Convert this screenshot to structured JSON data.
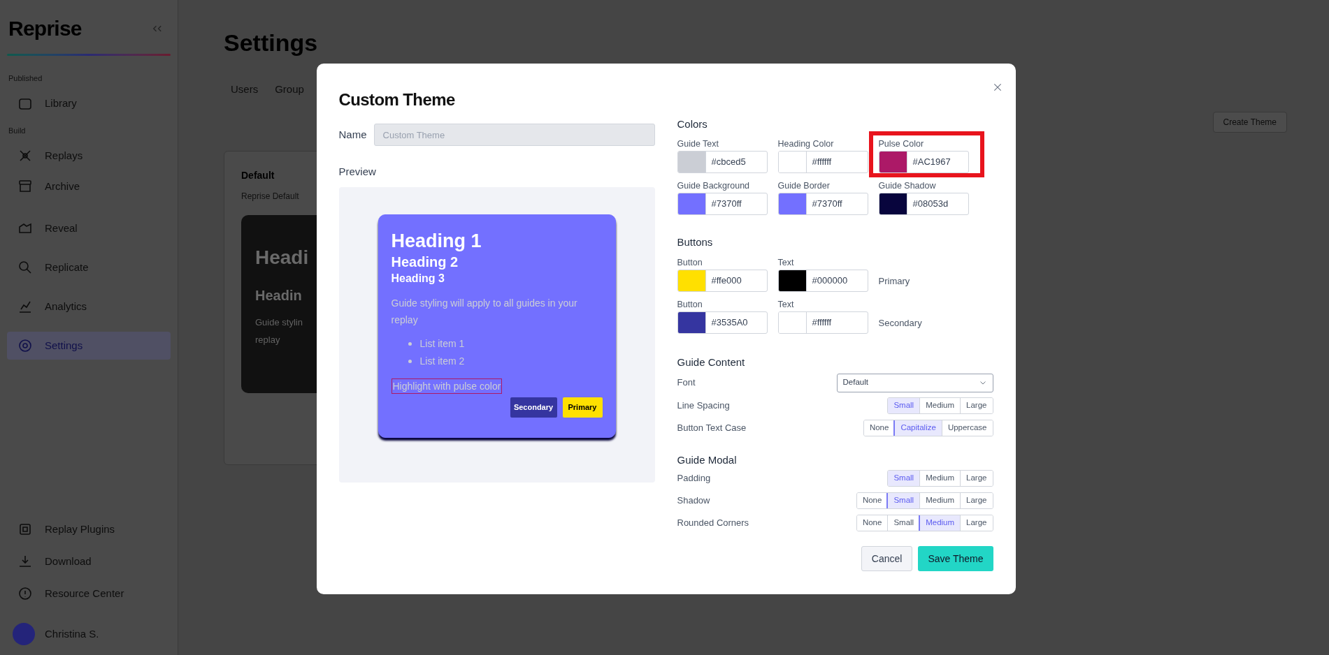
{
  "sidebar": {
    "logo": "Reprise",
    "sections": [
      {
        "heading": "Published",
        "items": [
          {
            "label": "Library",
            "selected": false
          }
        ]
      },
      {
        "heading": "Build",
        "items": [
          {
            "label": "Replays",
            "selected": false
          },
          {
            "label": "Archive",
            "selected": false
          },
          {
            "label": "Reveal",
            "selected": false
          },
          {
            "label": "Replicate",
            "selected": false
          },
          {
            "label": "Analytics",
            "selected": false
          },
          {
            "label": "Settings",
            "selected": true
          }
        ]
      }
    ],
    "bottom_items": [
      {
        "label": "Replay Plugins",
        "selected": false
      },
      {
        "label": "Download",
        "selected": false
      },
      {
        "label": "Resource Center",
        "selected": false
      }
    ],
    "user": {
      "name": "Christina S."
    }
  },
  "page": {
    "title": "Settings",
    "tabs": [
      "Users",
      "Group"
    ],
    "create_button": "Create Theme",
    "theme_card": {
      "name": "Default",
      "subtitle": "Reprise Default",
      "preview_texts": [
        "Headi",
        "Headin",
        "Guide stylin",
        "replay"
      ]
    }
  },
  "modal": {
    "title": "Custom Theme",
    "name": {
      "label": "Name",
      "placeholder": "Custom Theme"
    },
    "preview": {
      "label": "Preview",
      "guide": {
        "heading_1": "Heading 1",
        "heading_2": "Heading 2",
        "heading_3": "Heading 3",
        "body": "Guide styling will apply to all guides in your replay",
        "list_items": [
          "List item 1",
          "List item 2"
        ],
        "highlight": "Highlight with pulse color",
        "buttons": [
          {
            "label": "Secondary",
            "kind": "secondary"
          },
          {
            "label": "Primary",
            "kind": "primary"
          }
        ]
      }
    },
    "colors": {
      "heading": "Colors",
      "fields": [
        {
          "label": "Guide Text",
          "value": "#cbced5",
          "color": "#cbced5",
          "highlighted": false
        },
        {
          "label": "Heading Color",
          "value": "#ffffff",
          "color": "#ffffff",
          "highlighted": false
        },
        {
          "label": "Pulse Color",
          "value": "#AC1967",
          "color": "#ac1967",
          "highlighted": true
        },
        {
          "label": "Guide Background",
          "value": "#7370ff",
          "color": "#7370ff",
          "highlighted": false
        },
        {
          "label": "Guide Border",
          "value": "#7370ff",
          "color": "#7370ff",
          "highlighted": false
        },
        {
          "label": "Guide Shadow",
          "value": "#08053d",
          "color": "#08053d",
          "highlighted": false
        }
      ]
    },
    "buttons": {
      "heading": "Buttons",
      "rows": [
        {
          "fields": [
            {
              "label": "Button",
              "value": "#ffe000",
              "color": "#ffe000"
            },
            {
              "label": "Text",
              "value": "#000000",
              "color": "#000000"
            }
          ],
          "caption": "Primary"
        },
        {
          "fields": [
            {
              "label": "Button",
              "value": "#3535A0",
              "color": "#3535a0"
            },
            {
              "label": "Text",
              "value": "#ffffff",
              "color": "#ffffff"
            }
          ],
          "caption": "Secondary"
        }
      ]
    },
    "guide_content": {
      "heading": "Guide Content",
      "font": {
        "label": "Font",
        "value": "Default"
      },
      "options": [
        {
          "label": "Line Spacing",
          "choices": [
            {
              "label": "Small",
              "selected": true
            },
            {
              "label": "Medium",
              "selected": false
            },
            {
              "label": "Large",
              "selected": false
            }
          ]
        },
        {
          "label": "Button Text Case",
          "choices": [
            {
              "label": "None",
              "selected": false
            },
            {
              "label": "Capitalize",
              "selected": true
            },
            {
              "label": "Uppercase",
              "selected": false
            }
          ]
        }
      ]
    },
    "guide_modal": {
      "heading": "Guide Modal",
      "options": [
        {
          "label": "Padding",
          "choices": [
            {
              "label": "Small",
              "selected": true
            },
            {
              "label": "Medium",
              "selected": false
            },
            {
              "label": "Large",
              "selected": false
            }
          ]
        },
        {
          "label": "Shadow",
          "choices": [
            {
              "label": "None",
              "selected": false
            },
            {
              "label": "Small",
              "selected": true
            },
            {
              "label": "Medium",
              "selected": false
            },
            {
              "label": "Large",
              "selected": false
            }
          ]
        },
        {
          "label": "Rounded Corners",
          "choices": [
            {
              "label": "None",
              "selected": false
            },
            {
              "label": "Small",
              "selected": false
            },
            {
              "label": "Medium",
              "selected": true
            },
            {
              "label": "Large",
              "selected": false
            }
          ]
        }
      ]
    },
    "actions": [
      {
        "label": "Cancel",
        "kind": "secondary"
      },
      {
        "label": "Save Theme",
        "kind": "primary"
      }
    ]
  }
}
